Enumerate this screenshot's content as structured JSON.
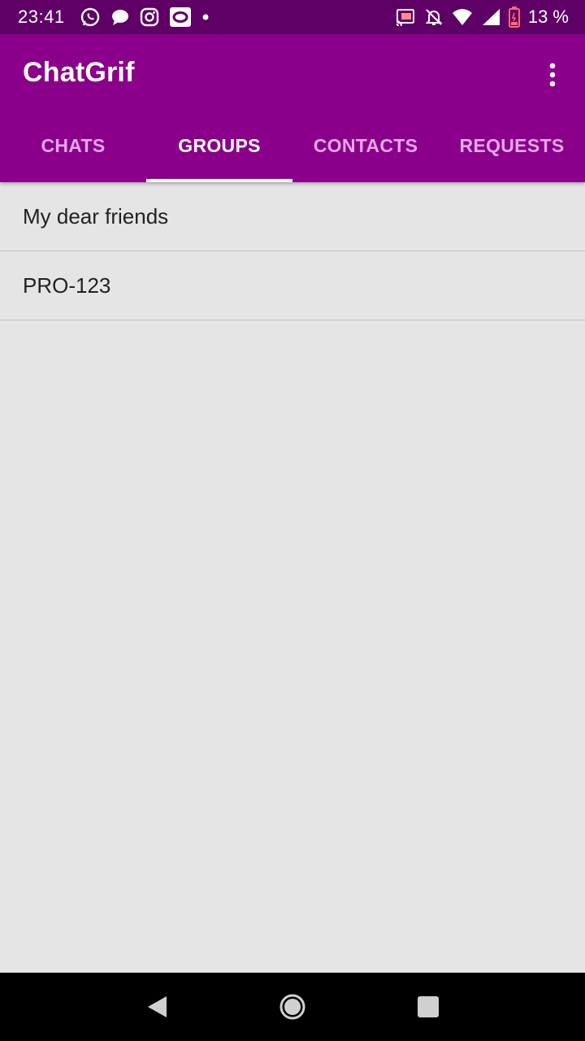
{
  "status_bar": {
    "time": "23:41",
    "left_icons": [
      "whatsapp-icon",
      "message-icon",
      "instagram-icon",
      "opera-icon",
      "dot-icon"
    ],
    "right_icons": [
      "cast-icon",
      "bell-off-icon",
      "wifi-icon",
      "signal-icon",
      "battery-icon"
    ],
    "battery_text": "13 %"
  },
  "app_bar": {
    "title": "ChatGrif",
    "menu_icon": "more-vert-icon",
    "background_color": "#8b008b"
  },
  "tabs": [
    {
      "label": "CHATS",
      "active": false
    },
    {
      "label": "GROUPS",
      "active": true
    },
    {
      "label": "CONTACTS",
      "active": false
    },
    {
      "label": "REQUESTS",
      "active": false
    }
  ],
  "groups": [
    {
      "name": "My dear friends"
    },
    {
      "name": "PRO-123"
    }
  ],
  "nav_bar": {
    "icons": [
      "back-icon",
      "home-icon",
      "recents-icon"
    ]
  }
}
